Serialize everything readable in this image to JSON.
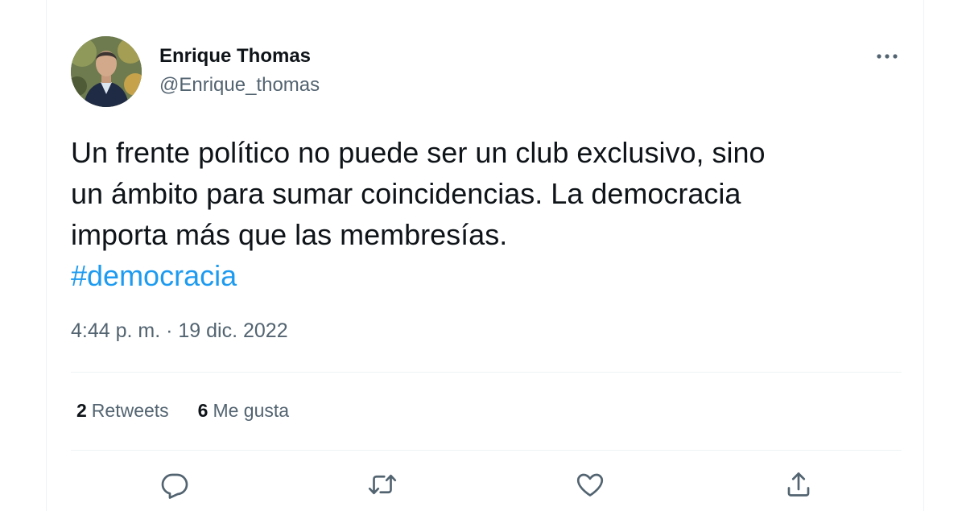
{
  "user": {
    "display_name": "Enrique Thomas",
    "handle": "@Enrique_thomas"
  },
  "tweet": {
    "lines": [
      "Un frente político no puede ser un club exclusivo, sino",
      "un ámbito para sumar coincidencias. La democracia",
      "importa más que las membresías."
    ],
    "hashtag": "#democracia",
    "timestamp": "4:44 p. m. · 19 dic. 2022"
  },
  "stats": {
    "retweets_count": "2",
    "retweets_label": "Retweets",
    "likes_count": "6",
    "likes_label": "Me gusta"
  },
  "actions": [
    {
      "icon": "reply-icon"
    },
    {
      "icon": "retweet-icon"
    },
    {
      "icon": "like-icon"
    },
    {
      "icon": "share-icon"
    }
  ],
  "colors": {
    "text": "#0f1419",
    "secondary": "#536471",
    "accent": "#1d9bf0",
    "divider": "#eff3f4"
  },
  "more_icon": "more-options-icon"
}
